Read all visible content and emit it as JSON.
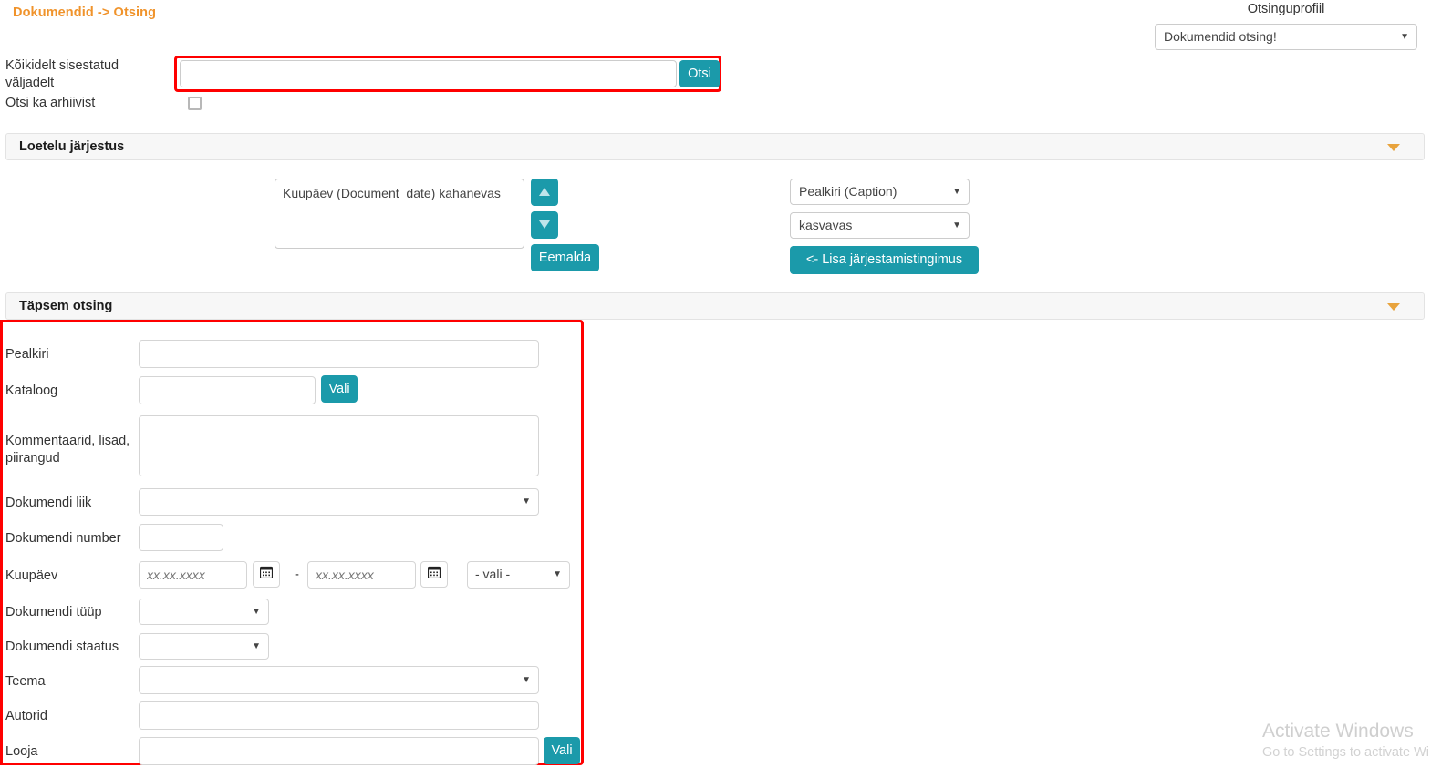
{
  "breadcrumb": "Dokumendid -> Otsing",
  "search_profile": {
    "label": "Otsinguprofiil",
    "selected": "Dokumendid otsing!",
    "caret": "▼"
  },
  "quick_search": {
    "label": "Kõikidelt sisestatud väljadelt",
    "value": "",
    "placeholder": "",
    "button_label": "Otsi",
    "archive_label": "Otsi ka arhiivist",
    "archive_checked": false
  },
  "order_panel": {
    "title": "Loetelu järjestus",
    "caret": "▼",
    "selected_rules": [
      "Kuupäev (Document_date) kahanevas"
    ],
    "move_up_label": "▲",
    "move_down_label": "▼",
    "remove_label": "Eemalda",
    "field_select": "Pealkiri (Caption)",
    "direction_select": "kasvavas",
    "add_rule_label": "<- Lisa järjestamistingimus",
    "caret_glyph": "▼"
  },
  "advanced_panel": {
    "title": "Täpsem otsing",
    "caret": "▼",
    "fields": {
      "pealkiri": {
        "label": "Pealkiri",
        "value": ""
      },
      "kataloog": {
        "label": "Kataloog",
        "value": "",
        "button_label": "Vali"
      },
      "kommentaarid": {
        "label": "Kommentaarid, lisad, piirangud",
        "value": ""
      },
      "dokumendi_liik": {
        "label": "Dokumendi liik",
        "value": ""
      },
      "dokumendi_number": {
        "label": "Dokumendi number",
        "value": ""
      },
      "kuupaev": {
        "label": "Kuupäev",
        "from_placeholder": "xx.xx.xxxx",
        "from_value": "",
        "to_placeholder": "xx.xx.xxxx",
        "to_value": "",
        "separator": "-",
        "mode_select": "- vali -",
        "calendar_glyph": "▦"
      },
      "dokumendi_tuup": {
        "label": "Dokumendi tüüp",
        "value": ""
      },
      "dokumendi_staatus": {
        "label": "Dokumendi staatus",
        "value": ""
      },
      "teema": {
        "label": "Teema",
        "value": ""
      },
      "autorid": {
        "label": "Autorid",
        "value": ""
      },
      "looja": {
        "label": "Looja",
        "value": "",
        "button_label": "Vali"
      }
    }
  },
  "watermark": {
    "line1": "Activate Windows",
    "line2": "Go to Settings to activate Wi"
  },
  "colors": {
    "accent_teal": "#1b9aaa",
    "breadcrumb_orange": "#f0932b",
    "highlight_red": "#ff0000",
    "caret_orange": "#e8a33d"
  }
}
